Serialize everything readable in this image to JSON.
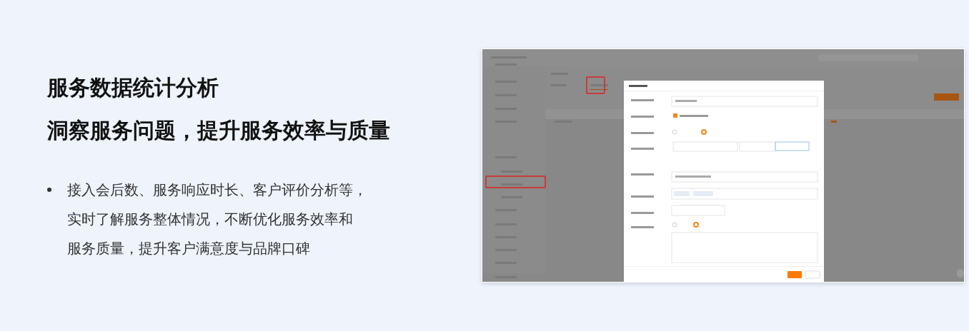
{
  "title": "服务数据统计分析",
  "subtitle": "洞察服务问题，提升服务效率与质量",
  "bullets": [
    {
      "lines": [
        "接入会后数、服务响应时长、客户评价分析等，",
        "实时了解服务整体情况，不断优化服务效率和",
        "服务质量，提升客户满意度与品牌口碑"
      ]
    }
  ]
}
